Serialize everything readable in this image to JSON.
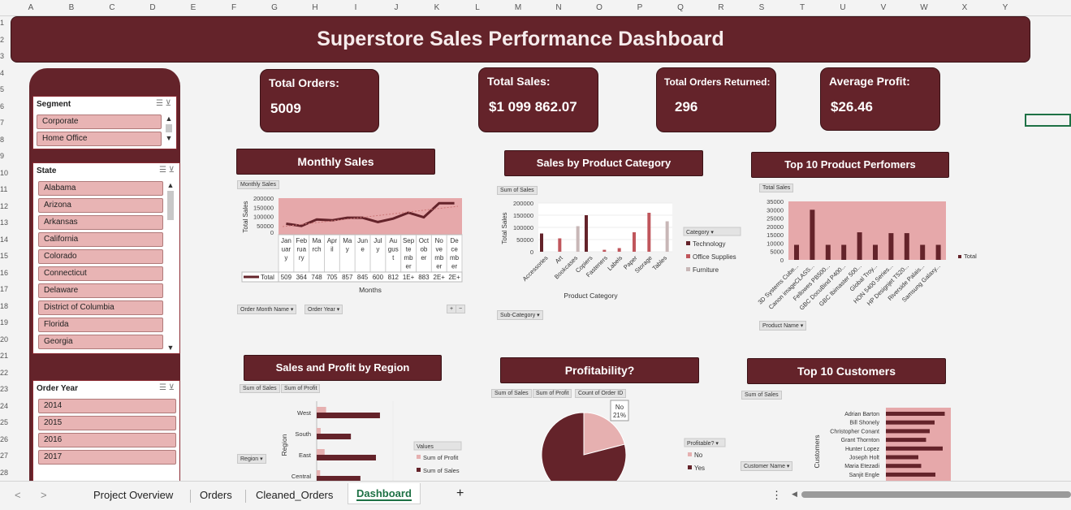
{
  "columns": [
    "A",
    "B",
    "C",
    "D",
    "E",
    "F",
    "G",
    "H",
    "I",
    "J",
    "K",
    "L",
    "M",
    "N",
    "O",
    "P",
    "Q",
    "R",
    "S",
    "T",
    "U",
    "V",
    "W",
    "X",
    "Y"
  ],
  "rows": [
    "1",
    "2",
    "3",
    "4",
    "5",
    "6",
    "7",
    "8",
    "9",
    "10",
    "11",
    "12",
    "13",
    "14",
    "15",
    "16",
    "17",
    "18",
    "19",
    "20",
    "21",
    "22",
    "23",
    "24",
    "25",
    "26",
    "27",
    "28"
  ],
  "title": "Superstore Sales Performance Dashboard",
  "kpis": [
    {
      "label": "Total Orders:",
      "value": "5009"
    },
    {
      "label": "Total Sales:",
      "value": "$1 099 862.07"
    },
    {
      "label": "Total Orders Returned:",
      "value": "296"
    },
    {
      "label": "Average Profit:",
      "value": "$26.46"
    }
  ],
  "slicers": {
    "segment": {
      "title": "Segment",
      "items": [
        "Corporate",
        "Home Office"
      ]
    },
    "state": {
      "title": "State",
      "items": [
        "Alabama",
        "Arizona",
        "Arkansas",
        "California",
        "Colorado",
        "Connecticut",
        "Delaware",
        "District of Columbia",
        "Florida",
        "Georgia"
      ]
    },
    "order_year": {
      "title": "Order Year",
      "items": [
        "2014",
        "2015",
        "2016",
        "2017"
      ]
    }
  },
  "chart_titles": {
    "monthly": "Monthly Sales",
    "category": "Sales by Product Category",
    "top10prod": "Top 10 Product Perfomers",
    "region": "Sales and Profit by Region",
    "profit": "Profitability?",
    "customers": "Top 10 Customers"
  },
  "pills": {
    "monthly_field": "Monthly Sales",
    "monthly_f1": "Order Month Name",
    "monthly_f2": "Order Year",
    "cat_field": "Sum of Sales",
    "cat_f1": "Sub-Category",
    "cat_legend_title": "Category",
    "top_field": "Total Sales",
    "top_f1": "Product Name",
    "reg_f1": "Sum of Sales",
    "reg_f2": "Sum of Profit",
    "reg_row": "Region",
    "reg_values": "Values",
    "prof_f1": "Sum of Sales",
    "prof_f2": "Sum of Profit",
    "prof_f3": "Count of Order ID",
    "prof_legend_title": "Profitable?",
    "cust_field": "Sum of Sales",
    "cust_row": "Customer Name"
  },
  "chart_data": [
    {
      "type": "line",
      "title": "Monthly Sales",
      "xlabel": "Months",
      "ylabel": "Total Sales",
      "ylim": [
        0,
        200000
      ],
      "yticks": [
        "200000",
        "150000",
        "100000",
        "50000",
        "0"
      ],
      "categories": [
        "January",
        "February",
        "March",
        "April",
        "May",
        "June",
        "July",
        "August",
        "September",
        "October",
        "November",
        "December"
      ],
      "category_labels": [
        [
          "Jan",
          "uar",
          "y"
        ],
        [
          "Feb",
          "rua",
          "ry"
        ],
        [
          "Ma",
          "rch"
        ],
        [
          "Apr",
          "il"
        ],
        [
          "Ma",
          "y"
        ],
        [
          "Jun",
          "e"
        ],
        [
          "Jul",
          "y"
        ],
        [
          "Au",
          "gus",
          "t"
        ],
        [
          "Sep",
          "te",
          "mb",
          "er"
        ],
        [
          "Oct",
          "ob",
          "er"
        ],
        [
          "No",
          "ve",
          "mb",
          "er"
        ],
        [
          "De",
          "ce",
          "mb",
          "er"
        ]
      ],
      "table_row_label": "Total",
      "table_values": [
        "509",
        "364",
        "748",
        "705",
        "857",
        "845",
        "600",
        "812",
        "1E+",
        "883",
        "2E+",
        "2E+"
      ],
      "series": [
        {
          "name": "Total",
          "values": [
            50000,
            37000,
            75000,
            70000,
            85000,
            85000,
            60000,
            80000,
            115000,
            88000,
            170000,
            170000
          ]
        }
      ]
    },
    {
      "type": "bar",
      "title": "Sales by Product Category",
      "xlabel": "Product Category",
      "ylabel": "Total Sales",
      "ylim": [
        0,
        200000
      ],
      "yticks": [
        "200000",
        "150000",
        "100000",
        "50000",
        "0"
      ],
      "categories": [
        "Accessories",
        "Art",
        "Bookcases",
        "Copiers",
        "Fasteners",
        "Labels",
        "Paper",
        "Storage",
        "Tables"
      ],
      "series": [
        {
          "name": "Technology",
          "values": [
            75000,
            0,
            0,
            150000,
            0,
            0,
            0,
            0,
            0
          ]
        },
        {
          "name": "Office Supplies",
          "values": [
            0,
            55000,
            0,
            0,
            8000,
            15000,
            80000,
            160000,
            0
          ]
        },
        {
          "name": "Furniture",
          "values": [
            0,
            0,
            105000,
            0,
            0,
            0,
            0,
            0,
            125000
          ]
        }
      ]
    },
    {
      "type": "bar",
      "title": "Top 10 Product Perfomers",
      "ylim": [
        0,
        35000
      ],
      "yticks": [
        "35000",
        "30000",
        "25000",
        "20000",
        "15000",
        "10000",
        "5000",
        "0"
      ],
      "categories": [
        "3D Systems Cube...",
        "Canon imageCLASS...",
        "Fellowes PB500...",
        "GBC DocuBind P400...",
        "GBC Ibimaster 500...",
        "Global Troy...",
        "HON 5400 Series...",
        "HP Designjet T520...",
        "Riverside Palais...",
        "Samsung Galaxy..."
      ],
      "series": [
        {
          "name": "Total",
          "values": [
            9000,
            30000,
            9000,
            9000,
            16500,
            9000,
            16000,
            16000,
            9000,
            9000
          ]
        }
      ]
    },
    {
      "type": "bar",
      "title": "Sales and Profit by Region",
      "ylabel": "Region",
      "categories": [
        "West",
        "South",
        "East",
        "Central"
      ],
      "series": [
        {
          "name": "Sum of Profit",
          "values": [
            108000,
            46000,
            91000,
            40000
          ]
        },
        {
          "name": "Sum of Sales",
          "values": [
            725000,
            392000,
            679000,
            501000
          ]
        }
      ]
    },
    {
      "type": "pie",
      "title": "Profitability?",
      "data_label": [
        "No",
        "21%"
      ],
      "categories": [
        "No",
        "Yes"
      ],
      "values": [
        21,
        79
      ],
      "colors": [
        "#e6b0b0",
        "#64232a"
      ]
    },
    {
      "type": "bar",
      "title": "Top 10 Customers",
      "ylabel": "Customers",
      "categories": [
        "Adrian Barton",
        "Bill Shonely",
        "Christopher Conant",
        "Grant Thornton",
        "Hunter Lopez",
        "Joseph Holt",
        "Maria Etezadi",
        "Sanjit Engle"
      ],
      "series": [
        {
          "name": "Total",
          "values": [
            14500,
            12000,
            10800,
            9900,
            14000,
            8000,
            8700,
            12200
          ]
        }
      ]
    }
  ],
  "sheets": {
    "tabs": [
      "Project Overview",
      "Orders",
      "Cleaned_Orders",
      "Dashboard"
    ],
    "active": "Dashboard",
    "add": "+",
    "more": "⋮"
  },
  "colors": {
    "maroon": "#64232a",
    "pink": "#e8b4b4",
    "plot_bg": "#e6a8aa",
    "light": "#c8b7b7",
    "mid": "#c0565c"
  }
}
